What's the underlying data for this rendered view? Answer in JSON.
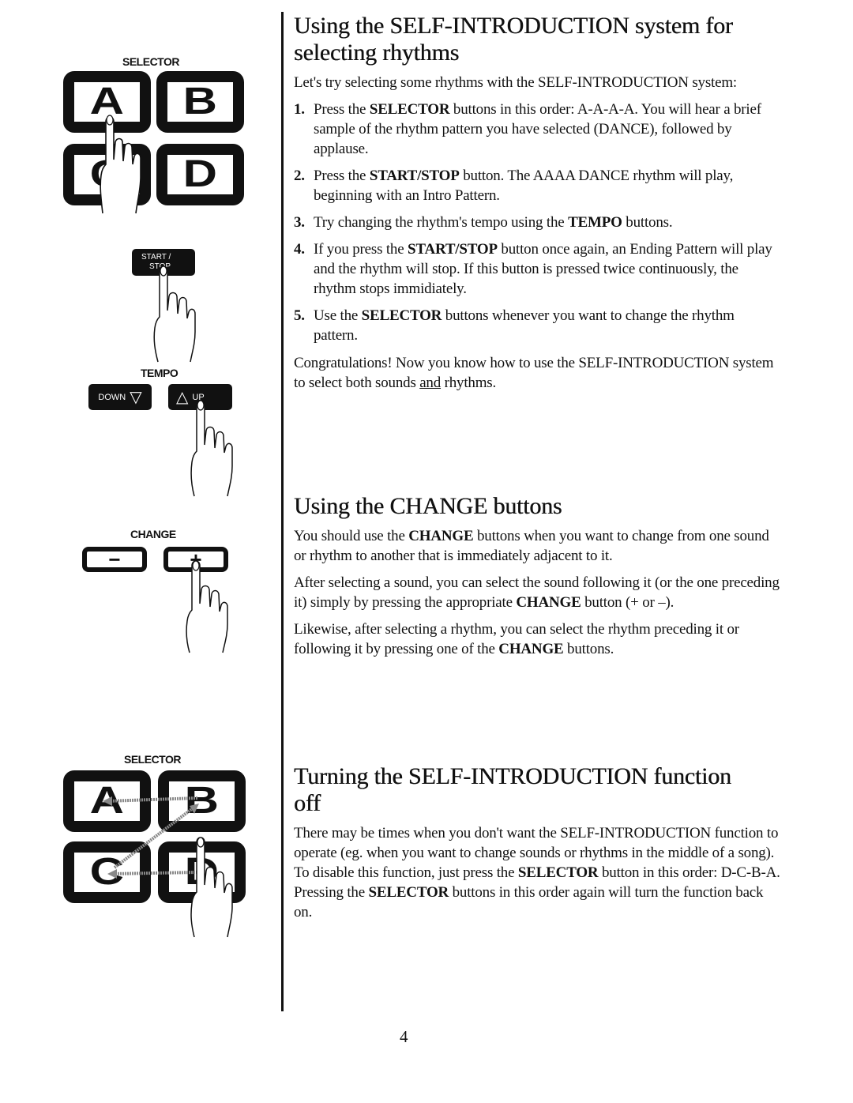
{
  "illustrations": {
    "selector_top": {
      "label": "SELECTOR",
      "buttons": [
        "A",
        "B",
        "C",
        "D"
      ],
      "pressed": "A"
    },
    "start_stop": {
      "label_line1": "START /",
      "label_line2": "STOP"
    },
    "tempo": {
      "label": "TEMPO",
      "down_label": "DOWN",
      "down_icon": "▽",
      "up_icon": "△",
      "up_label": "UP",
      "pressed": "UP"
    },
    "change": {
      "label": "CHANGE",
      "minus": "−",
      "plus": "+",
      "pressed": "+"
    },
    "selector_bottom": {
      "label": "SELECTOR",
      "buttons": [
        "A",
        "B",
        "C",
        "D"
      ],
      "pressed": "D",
      "sequence": "D-C-B-A"
    }
  },
  "sections": {
    "rhythms": {
      "title": "Using the SELF-INTRODUCTION system for selecting rhythms",
      "intro": "Let's try selecting some rhythms with the SELF-INTRODUCTION system:",
      "steps": [
        {
          "num": "1.",
          "pre": "Press the ",
          "bold": "SELECTOR",
          "post": " buttons in this order: A-A-A-A.  You will hear a brief sample of the rhythm pattern you have selected (DANCE), followed by applause."
        },
        {
          "num": "2.",
          "pre": "Press the ",
          "bold": "START/STOP",
          "post": " button.  The AAAA DANCE rhythm will play, beginning with an Intro Pattern."
        },
        {
          "num": "3.",
          "pre": "Try changing the rhythm's tempo using the ",
          "bold": "TEMPO",
          "post": " buttons."
        },
        {
          "num": "4.",
          "pre": "If you press the ",
          "bold": "START/STOP",
          "post": " button once again, an Ending Pattern will play and the rhythm will stop.  If this button is pressed twice continuously, the rhythm stops immidiately."
        },
        {
          "num": "5.",
          "pre": "Use the ",
          "bold": "SELECTOR",
          "post": " buttons whenever you want to change the rhythm pattern."
        }
      ],
      "congrats_pre": "Congratulations! Now you know how to use the SELF-INTRODUCTION system to select both sounds ",
      "congrats_underline": "and",
      "congrats_post": " rhythms."
    },
    "change": {
      "title": "Using the CHANGE buttons",
      "p1_pre": "You should use the ",
      "p1_bold": "CHANGE",
      "p1_post": " buttons when you want to change from one sound or rhythm to another that is immediately adjacent to it.",
      "p2_pre": "After selecting a sound, you can select the sound following it (or the one preceding it) simply by pressing the appropriate ",
      "p2_bold": "CHANGE",
      "p2_post": " button (+ or –).",
      "p3_pre": "Likewise, after selecting a rhythm, you can select the rhythm preceding it or following it by pressing one of the ",
      "p3_bold": "CHANGE",
      "p3_post": " buttons."
    },
    "off": {
      "title": "Turning the SELF-INTRODUCTION function off",
      "p1_pre": "There may be times when you don't want the SELF-INTRODUCTION function to operate (eg.  when you want to change sounds or rhythms in the middle of a song).  To disable this function, just press the ",
      "p1_bold1": "SELECTOR",
      "p1_mid": " button in this order: D-C-B-A.  Pressing the ",
      "p1_bold2": "SELECTOR",
      "p1_post": " buttons in this order again will turn the function back on."
    }
  },
  "page_number": "4"
}
